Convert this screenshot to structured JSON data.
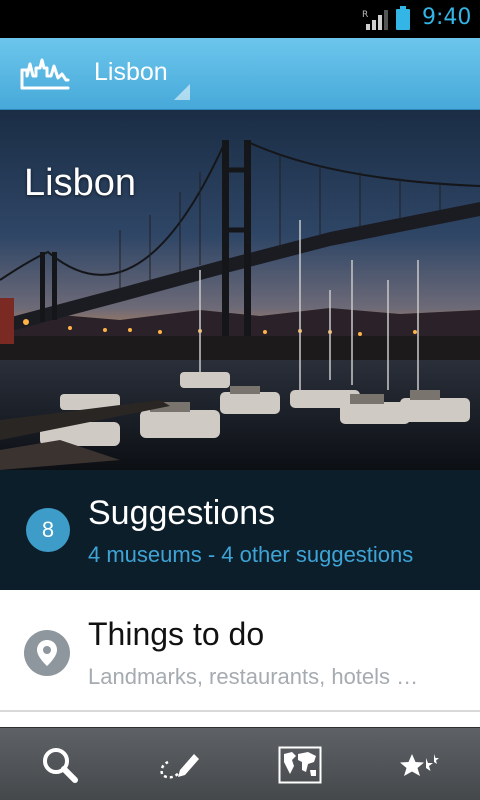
{
  "status_bar": {
    "time": "9:40",
    "signal_icon": "signal-roaming-icon",
    "battery_icon": "battery-icon"
  },
  "action_bar": {
    "app_icon": "city-skyline-logo-icon",
    "city": "Lisbon"
  },
  "hero": {
    "title": "Lisbon",
    "image": "suspension bridge over marina at sunset"
  },
  "suggestions": {
    "count": "8",
    "title": "Suggestions",
    "subtitle": "4 museums - 4 other suggestions"
  },
  "things_to_do": {
    "icon": "map-pin-icon",
    "title": "Things to do",
    "subtitle": "Landmarks, restaurants, hotels …"
  },
  "bottom_nav": {
    "items": [
      "search-icon",
      "edit-trip-icon",
      "world-map-icon",
      "favorites-stars-icon"
    ]
  },
  "colors": {
    "accent": "#33b5e5",
    "action_bar": "#52b2de",
    "suggestions_bg": "#0d1e2b",
    "badge": "#3d9cc8",
    "subtitle_blue": "#3ea4d6"
  }
}
